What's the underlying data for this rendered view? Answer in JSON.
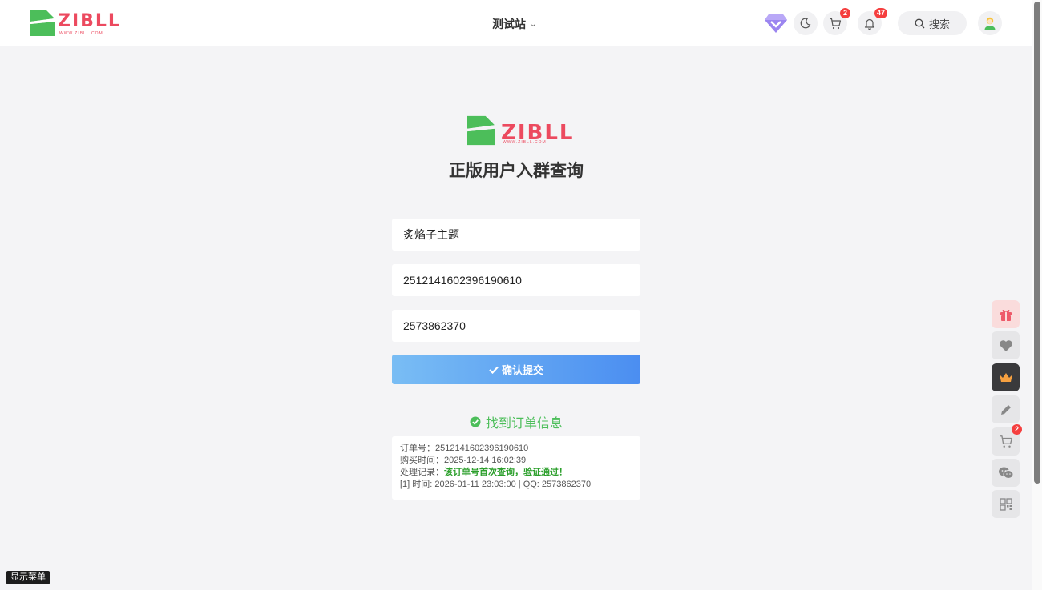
{
  "header": {
    "logo_text": "ZIBLL",
    "logo_sub": "WWW.ZIBLL.COM",
    "site_menu_label": "测试站",
    "cart_badge": "2",
    "notification_badge": "47",
    "search_label": "搜索"
  },
  "main": {
    "brand_text": "ZIBLL",
    "brand_sub": "WWW.ZIBLL.COM",
    "title": "正版用户入群查询",
    "fields": {
      "product_value": "炙焰子主题",
      "order_value": "2512141602396190610",
      "qq_value": "2573862370"
    },
    "submit_label": "确认提交",
    "result": {
      "title": "找到订单信息",
      "order_label": "订单号：",
      "order_value": "2512141602396190610",
      "time_label": "购买时间：",
      "time_value": "2025-12-14 16:02:39",
      "process_label": "处理记录：",
      "process_value": "该订单号首次查询，验证通过！",
      "record_line": "[1] 时间: 2026-01-11 23:03:00 | QQ: 2573862370"
    }
  },
  "float_toolbar": {
    "cart_badge": "2"
  },
  "show_menu_label": "显示菜单",
  "colors": {
    "accent_green": "#4cbe5a",
    "logo_red": "#ec4a5f",
    "badge_red": "#f53f3f",
    "button_gradient_start": "#79bdf4",
    "button_gradient_end": "#4b8ef1"
  }
}
